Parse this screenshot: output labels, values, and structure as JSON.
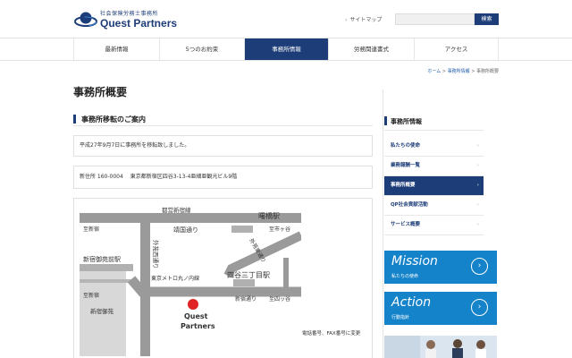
{
  "header": {
    "logo_subtitle": "社会保険労務士事務所",
    "logo_name": "Quest Partners",
    "sitemap_label": "サイトマップ",
    "search_placeholder": "",
    "search_button": "検索"
  },
  "nav": {
    "items": [
      {
        "label": "最新情報"
      },
      {
        "label": "5つのお約束"
      },
      {
        "label": "事務所情報",
        "active": true
      },
      {
        "label": "労務関連書式"
      },
      {
        "label": "アクセス"
      }
    ]
  },
  "breadcrumb": {
    "home": "ホーム",
    "sep": " > ",
    "parent": "事務所情報",
    "current": "事務所概要"
  },
  "main": {
    "title": "事務所概要",
    "section_heading": "事務所移転のご案内",
    "notice": "平成27年9月7日に事務所を移転致しました。",
    "address_postal": "新住所 160-0004",
    "address_text": "東京都新宿区四谷3-13-4亜細亜観光ビル9階",
    "map_labels": {
      "station_yotsuya": "曙橋駅",
      "road_top": "都営新宿線",
      "to_shinjuku": "至新宿",
      "to_ichigaya": "至市ヶ谷",
      "gaien_nishi": "外苑西通り",
      "yasukuni": "靖国通り",
      "gaien_higashi": "外苑東通り",
      "station_gyoen": "新宿御苑前駅",
      "marunouchi": "東京メトロ丸ノ内線",
      "station_sanchome": "四谷三丁目駅",
      "shinjuku_dori_left": "至新宿",
      "shinjuku_dori": "新宿通り",
      "to_yotsuya": "至四ッ谷",
      "park": "新宿御苑",
      "marker_name_1": "Quest",
      "marker_name_2": "Partners"
    },
    "map_note": "電話番号、FAX番号に変更"
  },
  "sidebar": {
    "title": "事務所情報",
    "items": [
      {
        "label": "私たちの使命"
      },
      {
        "label": "業務報酬一覧"
      },
      {
        "label": "事務所概要",
        "active": true
      },
      {
        "label": "QP社会貢献活動"
      },
      {
        "label": "サービス概要"
      }
    ],
    "promos": [
      {
        "title": "Mission",
        "subtitle": "私たちの使命"
      },
      {
        "title": "Action",
        "subtitle": "行動指針"
      }
    ]
  },
  "colors": {
    "brand_navy": "#1d3d78",
    "promo_blue": "#1583c9",
    "map_road": "#9a9a9a",
    "map_marker": "#e02424"
  }
}
